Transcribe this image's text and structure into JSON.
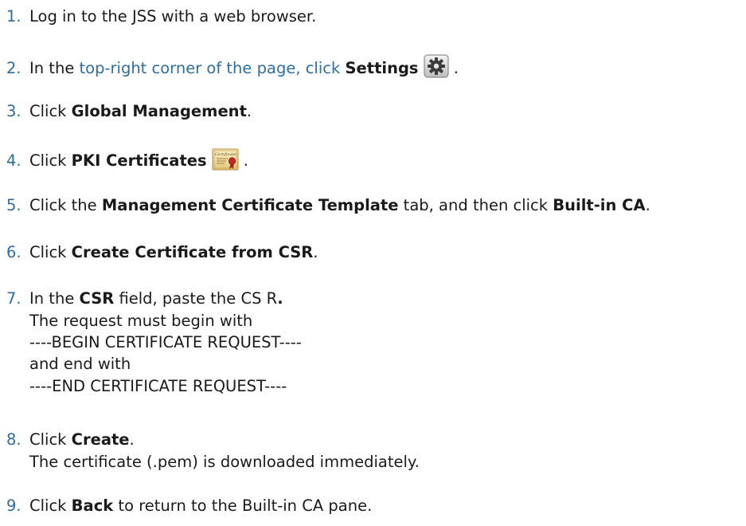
{
  "steps": [
    {
      "num": "1.",
      "t1": "Log in to the JSS with a web browser."
    },
    {
      "num": "2.",
      "t1": "In the ",
      "link": "top-right corner of the page, click ",
      "b1": "Settings",
      "t2": " ."
    },
    {
      "num": "3.",
      "t1": "Click ",
      "b1": "Global Management",
      "t2": "."
    },
    {
      "num": "4.",
      "t1": "Click ",
      "b1": "PKI Certificates",
      "t2": " ."
    },
    {
      "num": "5.",
      "t1": "Click the ",
      "b1": "Management Certificate Template",
      "t2": " tab, and then click ",
      "b2": "Built-in CA",
      "t3": "."
    },
    {
      "num": "6.",
      "t1": "Click ",
      "b1": "Create Certificate from CSR",
      "t2": "."
    },
    {
      "num": "7.",
      "t1": "In the ",
      "b1": "CSR",
      "t2": " field, paste the CS R",
      "t3": ".",
      "sub": [
        "The request must begin with",
        "----BEGIN CERTIFICATE REQUEST----",
        "and end with",
        "----END CERTIFICATE REQUEST----"
      ]
    },
    {
      "num": "8.",
      "t1": "Click ",
      "b1": "Create",
      "t2": ".",
      "sub": [
        "The certificate (.pem) is downloaded immediately."
      ]
    },
    {
      "num": "9.",
      "t1": "Click ",
      "b1": "Back",
      "t2": " to return to the Built-in CA pane."
    }
  ],
  "icons": {
    "settings": "gear-icon",
    "pki": "certificate-icon"
  },
  "colors": {
    "step_number": "#2e6e9e",
    "text": "#1a1a1a"
  }
}
